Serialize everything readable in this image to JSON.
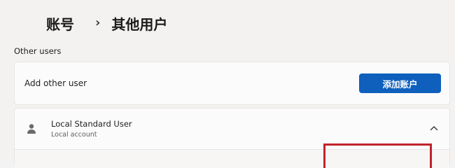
{
  "breadcrumb": {
    "root": "账号",
    "separator": "›",
    "current": "其他用户"
  },
  "section": {
    "title": "Other users"
  },
  "add_user": {
    "label": "Add other user",
    "button_label": "添加账户"
  },
  "user": {
    "name": "Local Standard User",
    "type": "Local account",
    "icon": "person-icon",
    "expand_icon": "chevron-up-icon"
  },
  "colors": {
    "accent": "#0f5fbd",
    "highlight": "#c0232b"
  }
}
